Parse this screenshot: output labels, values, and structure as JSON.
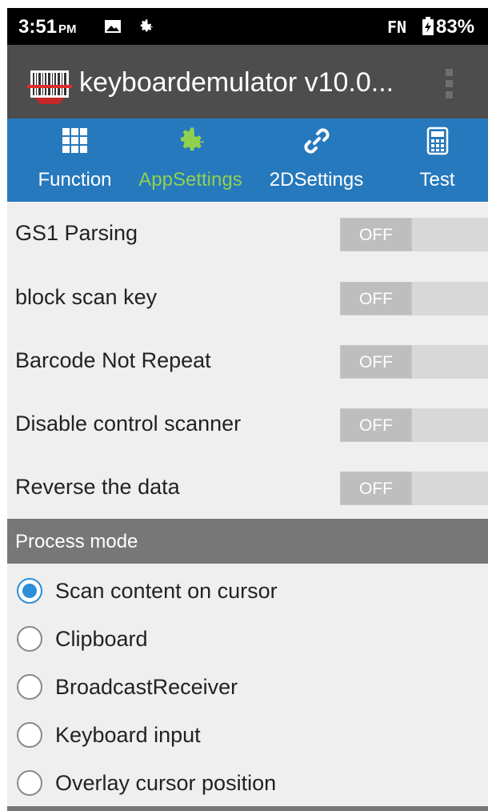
{
  "status_bar": {
    "time": "3:51",
    "ampm": "PM",
    "fn": "FN",
    "battery": "83%"
  },
  "app_bar": {
    "title": "keyboardemulator v10.0..."
  },
  "tabs": [
    {
      "label": "Function",
      "icon": "grid-icon",
      "active": false
    },
    {
      "label": "AppSettings",
      "icon": "gear-icon",
      "active": true
    },
    {
      "label": "2DSettings",
      "icon": "link-icon",
      "active": false
    },
    {
      "label": "Test",
      "icon": "calculator-icon",
      "active": false
    }
  ],
  "settings": [
    {
      "label": "GS1 Parsing",
      "state": "OFF"
    },
    {
      "label": "block scan key",
      "state": "OFF"
    },
    {
      "label": "Barcode Not Repeat",
      "state": "OFF"
    },
    {
      "label": "Disable control scanner",
      "state": "OFF"
    },
    {
      "label": "Reverse the data",
      "state": "OFF"
    }
  ],
  "process_mode": {
    "header": "Process mode",
    "options": [
      {
        "label": "Scan content on cursor",
        "selected": true
      },
      {
        "label": "Clipboard",
        "selected": false
      },
      {
        "label": "BroadcastReceiver",
        "selected": false
      },
      {
        "label": "Keyboard input",
        "selected": false
      },
      {
        "label": "Overlay cursor position",
        "selected": false
      }
    ]
  },
  "colors": {
    "tab_bar": "#2779bd",
    "active_tab": "#8fd14f",
    "app_bar": "#4d4d4d",
    "radio_accent": "#2d8ed8"
  }
}
